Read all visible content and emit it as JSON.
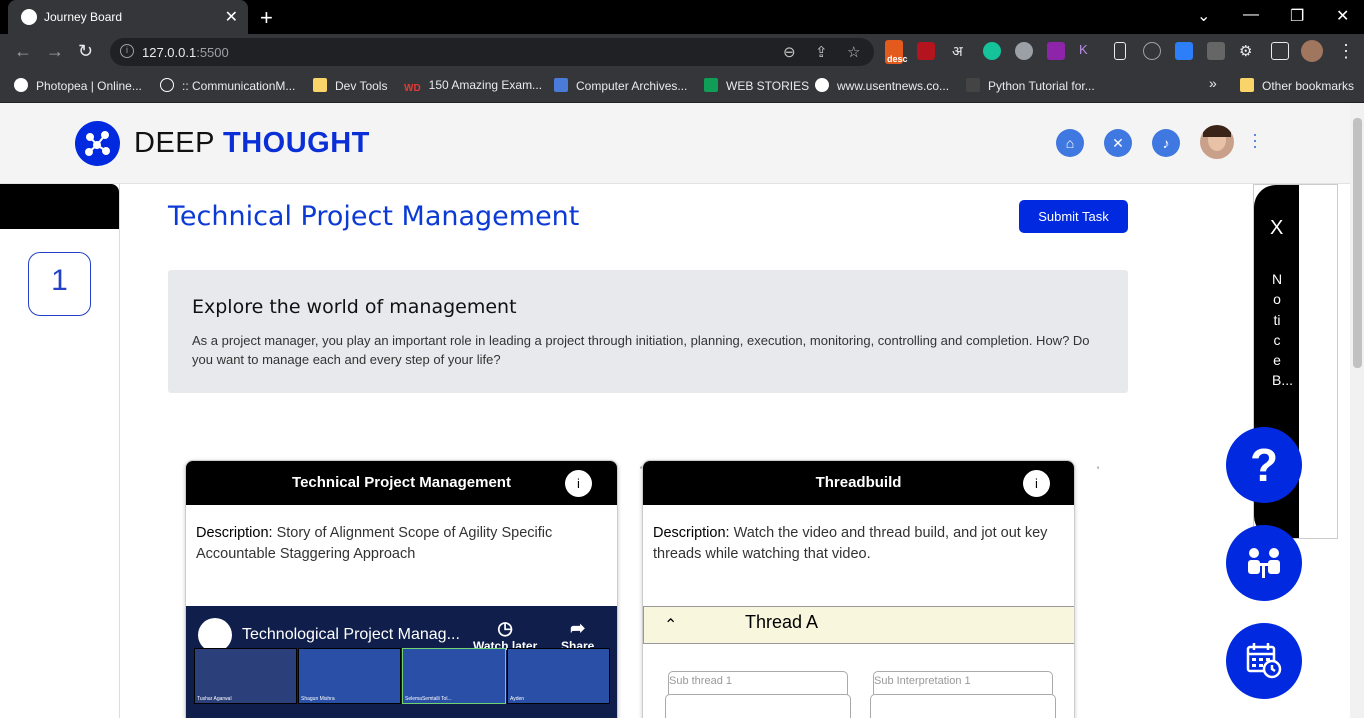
{
  "browser": {
    "tab_title": "Journey Board",
    "url_host": "127.0.0.1",
    "url_port": ":5500",
    "bookmarks": [
      {
        "label": "Photopea | Online..."
      },
      {
        "label": ":: CommunicationM..."
      },
      {
        "label": "Dev Tools"
      },
      {
        "label": "150 Amazing Exam..."
      },
      {
        "label": "Computer Archives..."
      },
      {
        "label": "WEB STORIES"
      },
      {
        "label": "www.usentnews.co..."
      },
      {
        "label": "Python Tutorial for..."
      }
    ],
    "bookmarks_overflow": "»",
    "other_bookmarks": "Other bookmarks",
    "ext_desc_label": "desc",
    "ext_hindi_label": "अ"
  },
  "header": {
    "logo_word1": "DEEP ",
    "logo_word2": "THOUGHT"
  },
  "sidebar": {
    "step_number": "1"
  },
  "main": {
    "title": "Technical Project Management",
    "submit_label": "Submit Task",
    "intro_heading": "Explore the world of management",
    "intro_text": "As a project manager, you play an important role in leading a project through initiation, planning, execution, monitoring, controlling and completion. How? Do you want to manage each and every step of your life?"
  },
  "cards": [
    {
      "title": "Technical Project Management",
      "info": "i",
      "desc_label": "Description:",
      "desc_text": " Story of Alignment Scope of Agility Specific Accountable Staggering Approach",
      "video_title": "Technological Project Manag...",
      "watch_later": "Watch later",
      "share": "Share",
      "thumb_names": [
        "Tushar Agarwal",
        "Shagun Mishra",
        "SelemaSemtalli Tol...",
        "Ayden"
      ]
    },
    {
      "title": "Threadbuild",
      "info": "i",
      "desc_label": "Description:",
      "desc_text": " Watch the video and thread build, and jot out key threads while watching that video.",
      "thread_label": "Thread A",
      "sub_thread": "Sub thread 1",
      "sub_interp": "Sub Interpretation 1"
    }
  ],
  "notice": {
    "close": "X",
    "label": "Notice B..."
  },
  "fab": {
    "help": "?"
  }
}
